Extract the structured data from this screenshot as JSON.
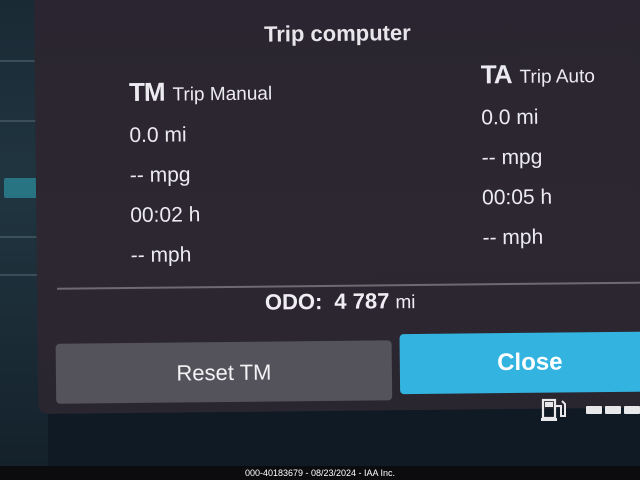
{
  "dialog": {
    "title": "Trip computer",
    "trip_manual": {
      "abbr": "TM",
      "name": "Trip Manual",
      "distance": "0.0 mi",
      "economy": "-- mpg",
      "time": "00:02 h",
      "speed": "-- mph"
    },
    "trip_auto": {
      "abbr": "TA",
      "name": "Trip Auto",
      "distance": "0.0 mi",
      "economy": "-- mpg",
      "time": "00:05 h",
      "speed": "-- mph"
    },
    "odometer": {
      "label": "ODO:",
      "value": "4 787",
      "unit": "mi"
    },
    "buttons": {
      "reset_label": "Reset TM",
      "close_label": "Close"
    }
  },
  "colors": {
    "dialog_bg": "#2a2530",
    "reset_button": "#54525a",
    "close_button": "#33b4e0"
  },
  "icons": [
    "fuel-pump-icon",
    "fuel-level-bars-icon"
  ],
  "footer": {
    "caption": "000-40183679 - 08/23/2024 - IAA Inc."
  }
}
